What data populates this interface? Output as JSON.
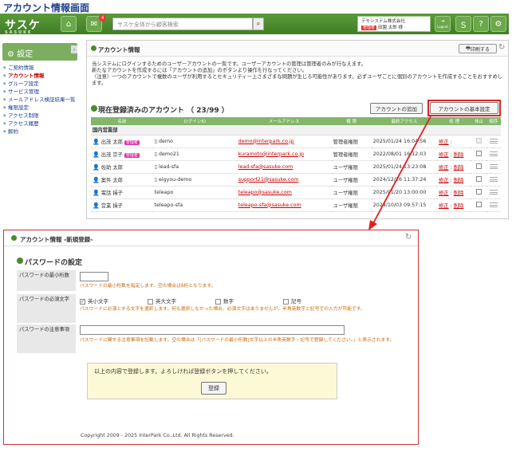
{
  "page_heading": "アカウント情報画面",
  "topbar": {
    "logo": "サスケ",
    "logo_sub": "SASUKE",
    "notification_count": "4",
    "search_placeholder": "サスケ全体から顧客検索",
    "company_name": "デモシステム株式会社",
    "user_role": "管理者",
    "user_name": "田園 太郎 様",
    "logout_label": "Logout"
  },
  "sidebar": {
    "title": "設定",
    "items": [
      {
        "label": "ご契約情報",
        "state": "link"
      },
      {
        "label": "アカウント情報",
        "state": "active"
      },
      {
        "label": "グループ設定",
        "state": "link"
      },
      {
        "label": "サービス管理",
        "state": "link"
      },
      {
        "label": "メールアドレス検証結果一覧",
        "state": "link"
      },
      {
        "label": "権限設定",
        "state": "link"
      },
      {
        "label": "アクセス制限",
        "state": "link"
      },
      {
        "label": "アクセス履歴",
        "state": "link"
      },
      {
        "label": "解約",
        "state": "link"
      }
    ]
  },
  "account_panel": {
    "title": "アカウント情報",
    "print_label": "印刷する",
    "description": [
      "当システムにログインするためのユーザーアカウントの一覧です。ユーザーアカウントの管理は管理者のみが行なえます。",
      "新たなアカウントを作成するには「アカウントの追加」のボタンより操作を行なってください。",
      "（注意）一つのアカウントで複数のユーザが利用するとセキュリティー上さまざまな問題が生じる可能性があります。必ずユーザごとに個別のアカウントを作成することをおすすめします。"
    ],
    "section_title": "現在登録済みのアカウント",
    "section_count": "（ 23/99 ）",
    "add_button": "アカウントの追加",
    "basic_settings_button": "アカウントの基本設定",
    "columns": [
      "名前",
      "ログインID",
      "メールアドレス",
      "権 限",
      "最終アクセス",
      "処 理",
      "休止",
      "順序"
    ],
    "group_name": "国内営業部",
    "admin_tag": "管理者",
    "edit_label": "修正",
    "delete_label": "削除",
    "rows": [
      {
        "name": "出茂 太郎",
        "admin": true,
        "icon_color": "blue",
        "login": "demo",
        "phone": true,
        "email": "demo@interpark.co.jp",
        "role": "管理者権限",
        "last": "2025/01/24 16:04:56",
        "deletable": false
      },
      {
        "name": "出茂 京子",
        "admin": true,
        "icon_color": "blue",
        "login": "demo21",
        "phone": true,
        "email": "kuramoto@interpark.co.jp",
        "role": "管理者権限",
        "last": "2022/08/01 16:12:03",
        "deletable": true
      },
      {
        "name": "佐助 太郎",
        "admin": false,
        "icon_color": "orange",
        "login": "lead-sfa",
        "phone": true,
        "email": "lead-sfa@sasuke.com",
        "role": "ユーザ権限",
        "last": "2025/01/24 13:23:08",
        "deletable": true
      },
      {
        "name": "案件 太郎",
        "admin": false,
        "icon_color": "gray",
        "login": "eigyou-demo",
        "phone": true,
        "email": "support21@sasuke.com",
        "role": "ユーザ権限",
        "last": "2024/12/26 11:37:24",
        "deletable": true
      },
      {
        "name": "電話 揖子",
        "admin": false,
        "icon_color": "orange",
        "login": "teleapo",
        "phone": false,
        "email": "teleapo@sasuke.com",
        "role": "ユーザ権限",
        "last": "2025/01/20 13:00:00",
        "deletable": true
      },
      {
        "name": "営業 揖子",
        "admin": false,
        "icon_color": "orange",
        "login": "teleapo-sfa",
        "phone": false,
        "email": "teleapo-sfa@sasuke.com",
        "role": "ユーザ権限",
        "last": "2024/10/03 09:57:15",
        "deletable": true
      }
    ]
  },
  "form_panel": {
    "title": "アカウント情報 -新規登録-",
    "section_title": "パスワードの設定",
    "min_length_label": "パスワードの最小桁数",
    "min_length_note": "パスワードの最小桁数を指定します。空の場合は6桁となります。",
    "required_chars_label": "パスワードの必須文字",
    "options": [
      {
        "label": "英小文字",
        "checked": true
      },
      {
        "label": "英大文字",
        "checked": false
      },
      {
        "label": "数字",
        "checked": false
      },
      {
        "label": "記号",
        "checked": false
      }
    ],
    "required_chars_note": "パスワードに必須とする文字を選択します。何も選択しなかった場合、必須文字はありませんが、半角英数字と記号での入力が可能です。",
    "notes_label": "パスワードの注意事項",
    "notes_note": "パスワードに関する注意事項を記載します。空の場合は「(パスワードの最小桁数)文字以上の半角英数字・記号で登録してください。」と表示されます。",
    "confirm_text": "以上の内容で登録します。よろしければ登録ボタンを押してください。",
    "register_button": "登録",
    "copyright": "Copyright 2009 - 2025 InterPark Co.,Ltd. All Rights Reserved."
  }
}
